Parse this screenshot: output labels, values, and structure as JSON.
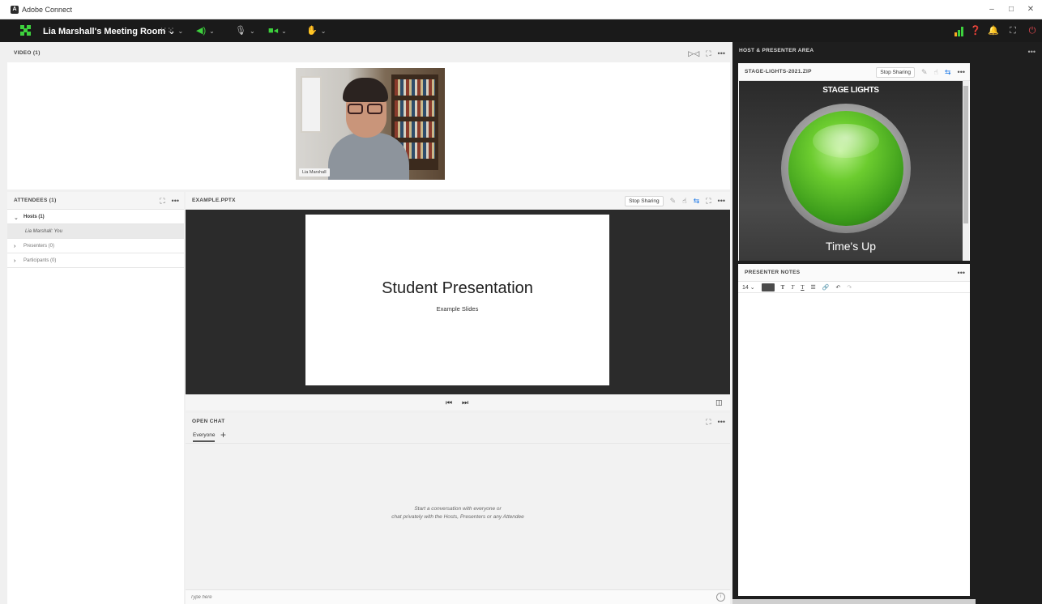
{
  "window": {
    "title": "Adobe Connect",
    "app_icon_letter": "A",
    "minimize": "–",
    "maximize": "□",
    "close": "✕"
  },
  "toolbar": {
    "room_title": "Lia Marshall's Meeting Room",
    "layouts_icon": "grid-icon",
    "audio_icon": "speaker-icon",
    "mic_icon": "microphone-icon",
    "camera_icon": "camera-icon",
    "raise_hand_icon": "hand-icon",
    "right_icons": [
      "signal-bars-icon",
      "help-icon",
      "bell-icon",
      "fullscreen-icon",
      "power-icon"
    ],
    "accent_green": "#3dd13d",
    "power_red": "#e34850"
  },
  "video": {
    "title": "VIDEO (1)",
    "participant_label": "Lia Marshall"
  },
  "attendees": {
    "title": "ATTENDEES (1)",
    "groups": [
      {
        "label": "Hosts (1)",
        "expanded": true
      },
      {
        "label": "Presenters (0)",
        "expanded": false
      },
      {
        "label": "Participants (0)",
        "expanded": false
      }
    ],
    "host_member": "Lia Marshall: You"
  },
  "share": {
    "title": "EXAMPLE.PPTX",
    "stop_sharing": "Stop Sharing",
    "slide_title": "Student Presentation",
    "slide_subtitle": "Example Slides"
  },
  "chat": {
    "title": "OPEN CHAT",
    "tab": "Everyone",
    "add_tab": "+",
    "empty_line1": "Start a conversation with everyone or",
    "empty_line2": "chat privately with the Hosts, Presenters or any Attendee",
    "input_placeholder": "Type here"
  },
  "host_area": {
    "title": "HOST & PRESENTER AREA",
    "stage": {
      "title": "STAGE-LIGHTS-2021.ZIP",
      "stop_sharing": "Stop Sharing",
      "heading": "STAGE LIGHTS",
      "caption": "Time's Up"
    },
    "notes": {
      "title": "PRESENTER NOTES",
      "font_size": "14"
    }
  }
}
